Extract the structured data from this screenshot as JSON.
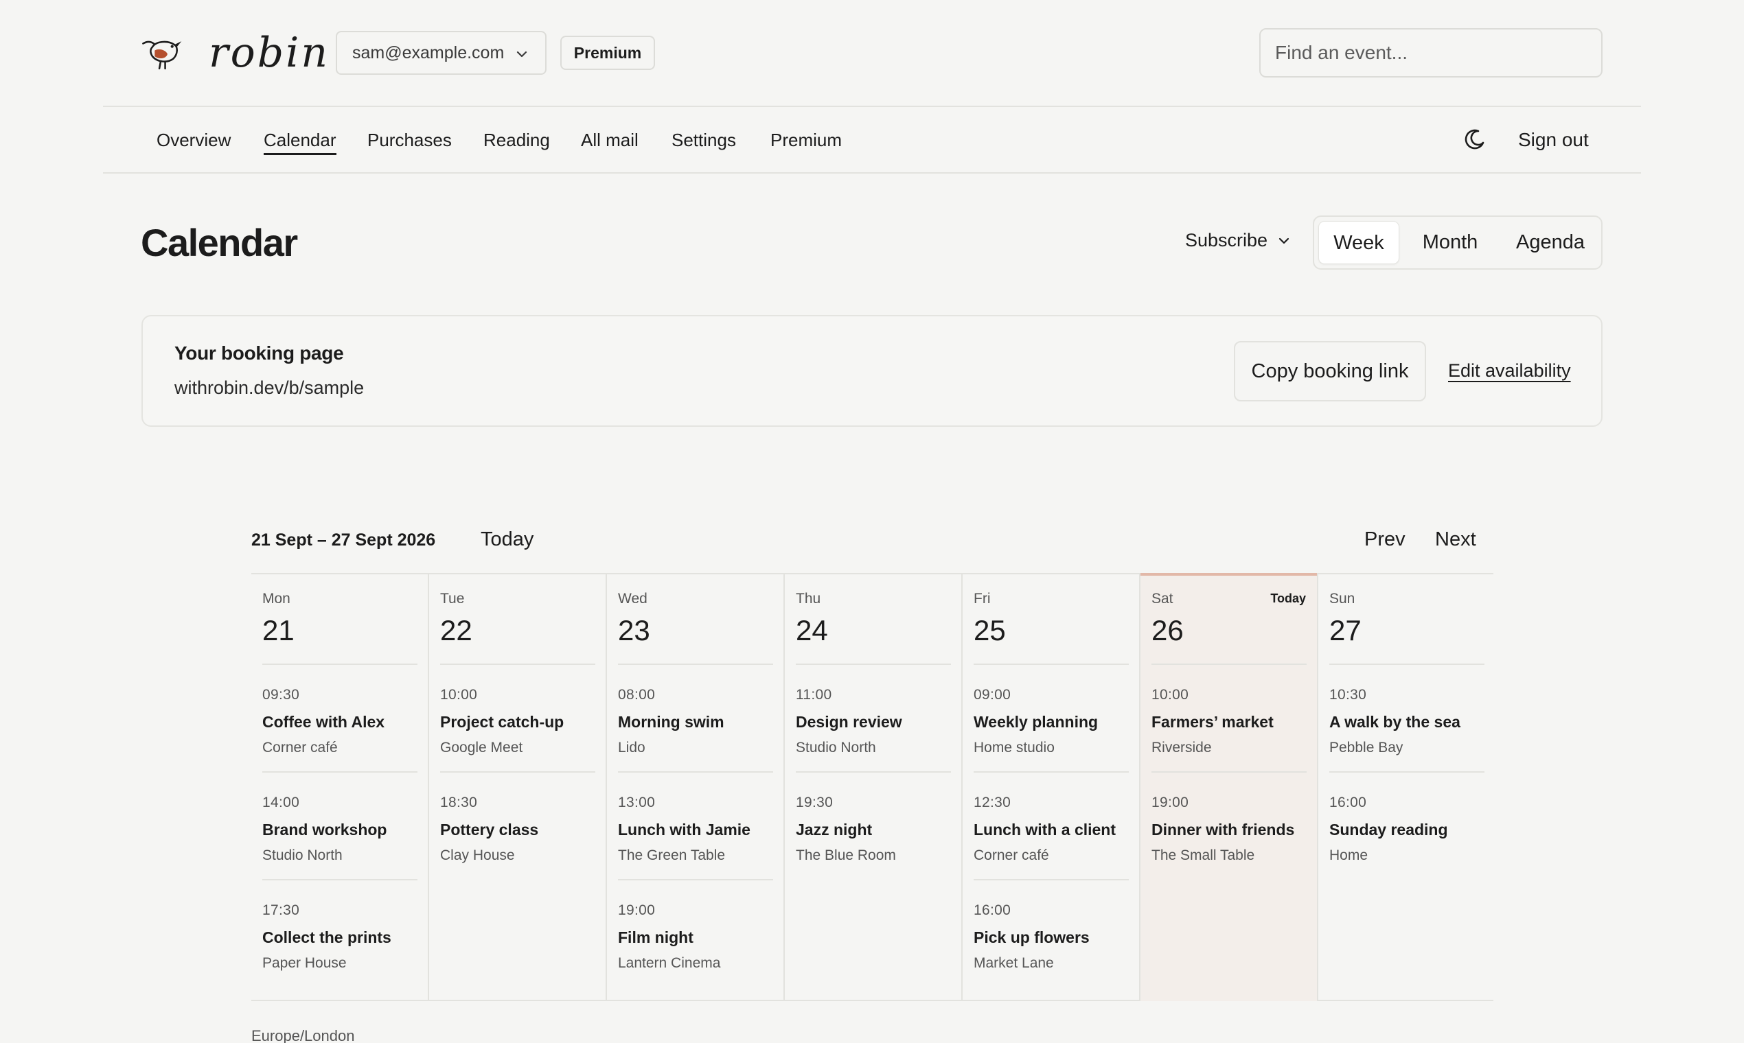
{
  "brand": {
    "name": "robin"
  },
  "header": {
    "account": "sam@example.com",
    "badge": "Premium",
    "search_placeholder": "Find an event..."
  },
  "nav": {
    "items": [
      "Overview",
      "Calendar",
      "Purchases",
      "Reading",
      "All mail",
      "Settings",
      "Premium"
    ],
    "active": "Calendar",
    "theme_icon": "moon-icon",
    "sign_out": "Sign out"
  },
  "page": {
    "title": "Calendar",
    "subscribe": "Subscribe",
    "views": [
      "Week",
      "Month",
      "Agenda"
    ],
    "active_view": "Week"
  },
  "booking": {
    "title": "Your booking page",
    "url": "withrobin.dev/b/sample",
    "copy_label": "Copy booking link",
    "edit_label": "Edit availability"
  },
  "week": {
    "range": "21 Sept – 27 Sept 2026",
    "today_label": "Today",
    "prev_label": "Prev",
    "next_label": "Next",
    "today_tag": "Today",
    "timezone": "Europe/London",
    "accent_today": "#e2b8a8",
    "days": [
      {
        "dow": "Mon",
        "num": "21",
        "today": false,
        "events": [
          {
            "time": "09:30",
            "title": "Coffee with Alex",
            "place": "Corner café"
          },
          {
            "time": "14:00",
            "title": "Brand workshop",
            "place": "Studio North"
          },
          {
            "time": "17:30",
            "title": "Collect the prints",
            "place": "Paper House"
          }
        ]
      },
      {
        "dow": "Tue",
        "num": "22",
        "today": false,
        "events": [
          {
            "time": "10:00",
            "title": "Project catch-up",
            "place": "Google Meet"
          },
          {
            "time": "18:30",
            "title": "Pottery class",
            "place": "Clay House"
          }
        ]
      },
      {
        "dow": "Wed",
        "num": "23",
        "today": false,
        "events": [
          {
            "time": "08:00",
            "title": "Morning swim",
            "place": "Lido"
          },
          {
            "time": "13:00",
            "title": "Lunch with Jamie",
            "place": "The Green Table"
          },
          {
            "time": "19:00",
            "title": "Film night",
            "place": "Lantern Cinema"
          }
        ]
      },
      {
        "dow": "Thu",
        "num": "24",
        "today": false,
        "events": [
          {
            "time": "11:00",
            "title": "Design review",
            "place": "Studio North"
          },
          {
            "time": "19:30",
            "title": "Jazz night",
            "place": "The Blue Room"
          }
        ]
      },
      {
        "dow": "Fri",
        "num": "25",
        "today": false,
        "events": [
          {
            "time": "09:00",
            "title": "Weekly planning",
            "place": "Home studio"
          },
          {
            "time": "12:30",
            "title": "Lunch with a client",
            "place": "Corner café"
          },
          {
            "time": "16:00",
            "title": "Pick up flowers",
            "place": "Market Lane"
          }
        ]
      },
      {
        "dow": "Sat",
        "num": "26",
        "today": true,
        "events": [
          {
            "time": "10:00",
            "title": "Farmers’ market",
            "place": "Riverside"
          },
          {
            "time": "19:00",
            "title": "Dinner with friends",
            "place": "The Small Table"
          }
        ]
      },
      {
        "dow": "Sun",
        "num": "27",
        "today": false,
        "events": [
          {
            "time": "10:30",
            "title": "A walk by the sea",
            "place": "Pebble Bay"
          },
          {
            "time": "16:00",
            "title": "Sunday reading",
            "place": "Home"
          }
        ]
      }
    ]
  }
}
